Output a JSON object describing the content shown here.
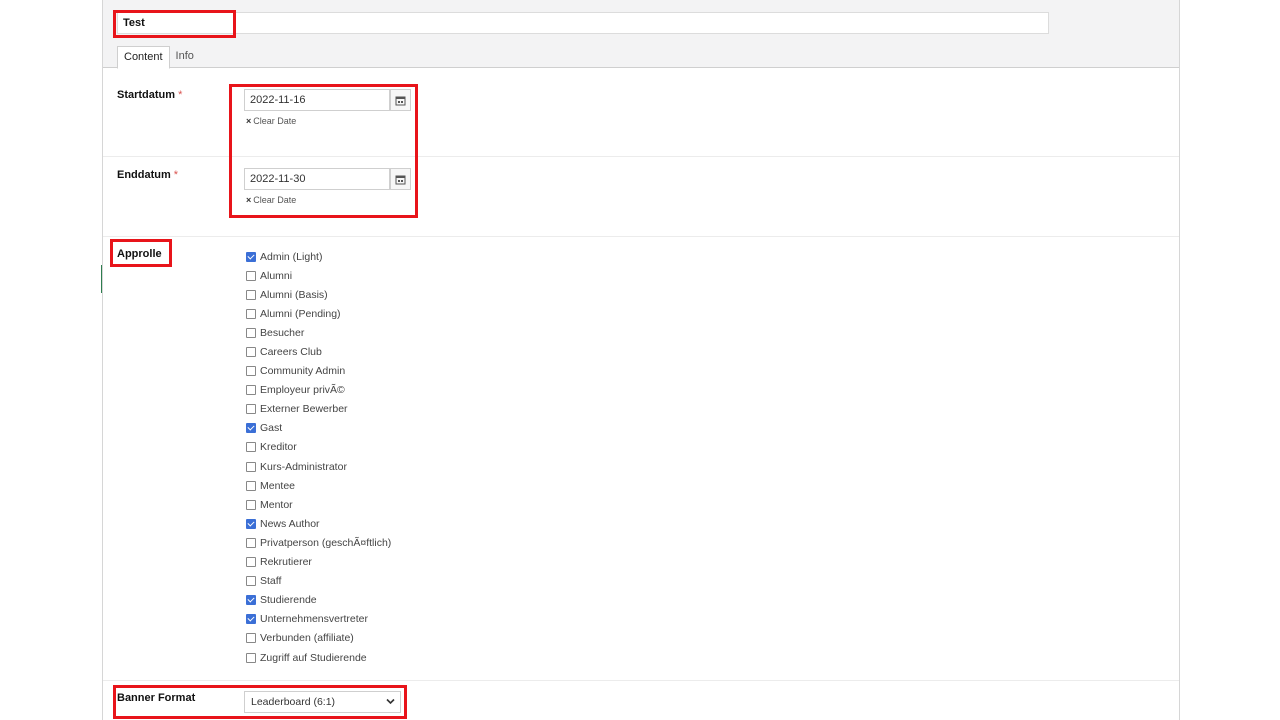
{
  "title_value": "Test",
  "tabs": [
    {
      "label": "Content",
      "active": true
    },
    {
      "label": "Info",
      "active": false
    }
  ],
  "start_date": {
    "label": "Startdatum",
    "required_mark": "*",
    "value": "2022-11-16",
    "clear_label": "Clear Date"
  },
  "end_date": {
    "label": "Enddatum",
    "required_mark": "*",
    "value": "2022-11-30",
    "clear_label": "Clear Date"
  },
  "clear_icon": "×",
  "approlle": {
    "label": "Approlle",
    "options": [
      {
        "label": "Admin (Light)",
        "checked": true
      },
      {
        "label": "Alumni",
        "checked": false
      },
      {
        "label": "Alumni (Basis)",
        "checked": false
      },
      {
        "label": "Alumni (Pending)",
        "checked": false
      },
      {
        "label": "Besucher",
        "checked": false
      },
      {
        "label": "Careers Club",
        "checked": false
      },
      {
        "label": "Community Admin",
        "checked": false
      },
      {
        "label": "Employeur privÃ©",
        "checked": false
      },
      {
        "label": "Externer Bewerber",
        "checked": false
      },
      {
        "label": "Gast",
        "checked": true
      },
      {
        "label": "Kreditor",
        "checked": false
      },
      {
        "label": "Kurs-Administrator",
        "checked": false
      },
      {
        "label": "Mentee",
        "checked": false
      },
      {
        "label": "Mentor",
        "checked": false
      },
      {
        "label": "News Author",
        "checked": true
      },
      {
        "label": "Privatperson (geschÃ¤ftlich)",
        "checked": false
      },
      {
        "label": "Rekrutierer",
        "checked": false
      },
      {
        "label": "Staff",
        "checked": false
      },
      {
        "label": "Studierende",
        "checked": true
      },
      {
        "label": "Unternehmensvertreter",
        "checked": true
      },
      {
        "label": "Verbunden (affiliate)",
        "checked": false
      },
      {
        "label": "Zugriff auf Studierende",
        "checked": false
      }
    ]
  },
  "banner_format": {
    "label": "Banner Format",
    "selected": "Leaderboard (6:1)"
  },
  "colors": {
    "highlight": "#e8141a",
    "checkbox_checked": "#3b6fd6",
    "required": "#d9534f"
  }
}
